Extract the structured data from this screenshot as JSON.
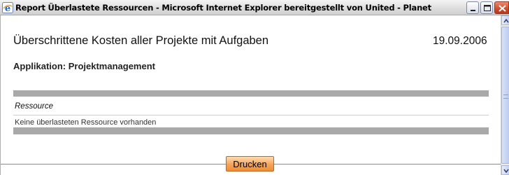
{
  "window": {
    "title": "Report Überlastete Ressourcen - Microsoft Internet Explorer bereitgestellt von United - Planet"
  },
  "report": {
    "title": "Überschrittene Kosten aller Projekte mit Aufgaben",
    "date": "19.09.2006",
    "application_label": "Applikation: Projektmanagement",
    "column_header": "Ressource",
    "empty_message": "Keine überlasteten Ressource vorhanden"
  },
  "actions": {
    "print_label": "Drucken"
  },
  "colors": {
    "bar": "#a9a9a9",
    "print_button": "#f6a356"
  }
}
